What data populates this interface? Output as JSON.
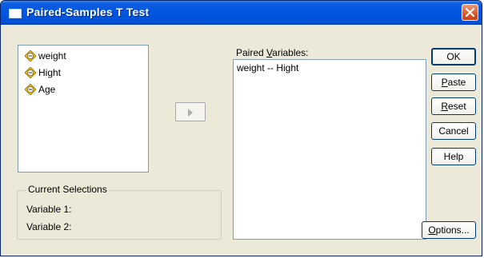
{
  "window": {
    "title": "Paired-Samples T Test"
  },
  "variables": [
    {
      "label": "weight",
      "icon": "scale-variable-icon"
    },
    {
      "label": "Hight",
      "icon": "scale-variable-icon"
    },
    {
      "label": "Age",
      "icon": "scale-variable-icon"
    }
  ],
  "paired": {
    "label_pre": "Paired ",
    "label_ul": "V",
    "label_post": "ariables:",
    "items": [
      "weight -- Hight"
    ]
  },
  "current_selections": {
    "title": "Current Selections",
    "variable1_label": "Variable 1:",
    "variable2_label": "Variable 2:"
  },
  "buttons": {
    "ok": "OK",
    "paste_ul": "P",
    "paste_rest": "aste",
    "reset_ul": "R",
    "reset_rest": "eset",
    "cancel": "Cancel",
    "help": "Help",
    "options_ul": "O",
    "options_rest": "ptions..."
  },
  "colors": {
    "titlebar": "#0052d6",
    "dialog_bg": "#ece9d8",
    "close": "#d9582c"
  }
}
